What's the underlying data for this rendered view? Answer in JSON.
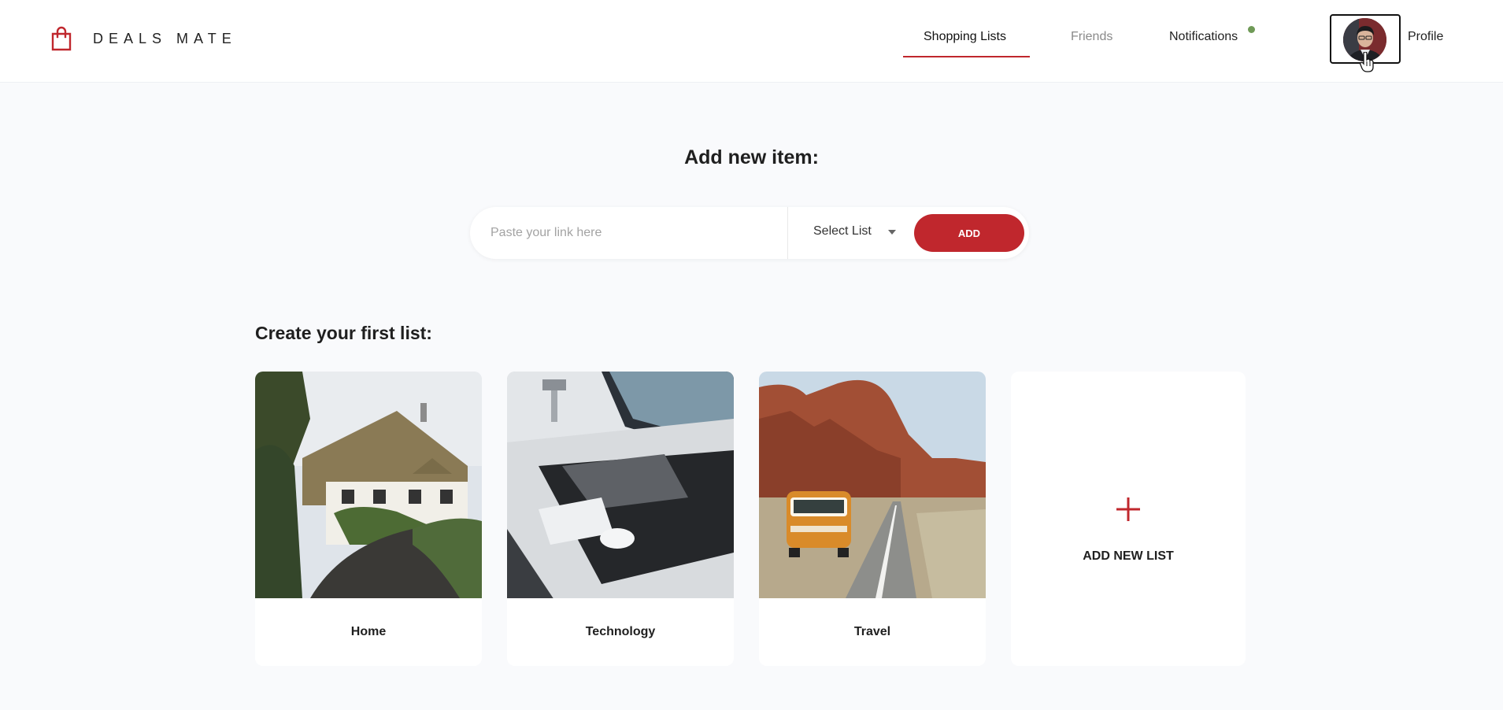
{
  "header": {
    "brand": "DEALS MATE",
    "nav": {
      "shopping_lists": "Shopping Lists",
      "friends": "Friends",
      "notifications": "Notifications",
      "profile": "Profile"
    }
  },
  "add_item": {
    "title": "Add new item:",
    "link_placeholder": "Paste your link here",
    "select_label": "Select List",
    "add_button": "ADD"
  },
  "lists": {
    "title": "Create your first list:",
    "cards": [
      {
        "label": "Home",
        "image": "cottage-photo"
      },
      {
        "label": "Technology",
        "image": "desk-setup-photo"
      },
      {
        "label": "Travel",
        "image": "desert-van-photo"
      }
    ],
    "add_new_label": "ADD NEW LIST"
  },
  "colors": {
    "accent": "#c0272d",
    "notification_dot": "#6f9a57",
    "background": "#f9fafc"
  },
  "icons": [
    "shopping-bag-icon",
    "caret-down-icon",
    "plus-icon",
    "hand-cursor-icon"
  ]
}
